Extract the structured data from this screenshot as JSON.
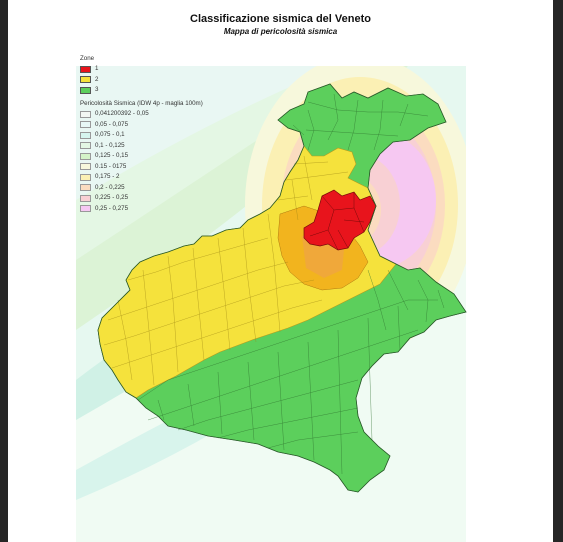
{
  "title": "Classificazione sismica del Veneto",
  "subtitle": "Mappa di pericolosità sismica",
  "legend": {
    "zone_heading": "Zone",
    "zones": [
      {
        "label": "1",
        "color": "#e8141c"
      },
      {
        "label": "2",
        "color": "#f5e23c"
      },
      {
        "label": "3",
        "color": "#5ccf5c"
      }
    ],
    "hazard_heading": "Pericolosità Sismica (IDW 4p - maglia 100m)",
    "hazard_classes": [
      {
        "label": "0,041200392 - 0,05",
        "color": "#f3f7f3"
      },
      {
        "label": "0,05 - 0,075",
        "color": "#e8f8f6"
      },
      {
        "label": "0,075 - 0,1",
        "color": "#d6f5ee"
      },
      {
        "label": "0,1 - 0,125",
        "color": "#e4f7e4"
      },
      {
        "label": "0,125 - 0,15",
        "color": "#d4f3c8"
      },
      {
        "label": "0.15 - 0175",
        "color": "#f7f8dc"
      },
      {
        "label": "0,175 - 2",
        "color": "#fbf0b4"
      },
      {
        "label": "0,2 - 0,225",
        "color": "#fbdcc0"
      },
      {
        "label": "0,225 - 0,25",
        "color": "#f8d0d4"
      },
      {
        "label": "0,25 - 0,275",
        "color": "#f6c8f2"
      }
    ]
  },
  "map": {
    "region": "Veneto",
    "zone_colors": {
      "zone1": "#e8141c",
      "zone2": "#f5e23c",
      "zone3": "#5ccf5c",
      "orange_band": "#f2b41e"
    }
  }
}
